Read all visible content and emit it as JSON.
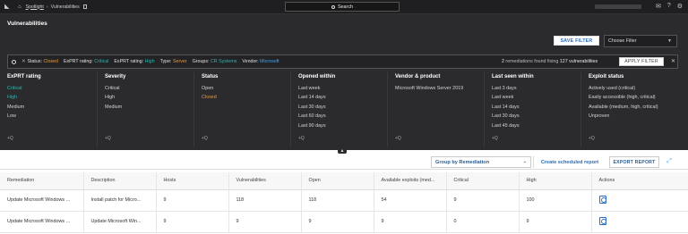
{
  "nav": {
    "app_name": "Spotlight",
    "page_name": "Vulnerabilities",
    "search_label": "Search"
  },
  "panel": {
    "title": "Vulnerabilities",
    "save_filter": "SAVE FILTER",
    "choose_filter": "Choose Filter"
  },
  "filters": [
    {
      "key": "Status:",
      "value": "Closed",
      "color": "orange"
    },
    {
      "key": "ExPRT rating:",
      "value": "Critical",
      "color": "teal"
    },
    {
      "key": "ExPRT rating:",
      "value": "High",
      "color": "teal"
    },
    {
      "key": "Type:",
      "value": "Server",
      "color": "orange"
    },
    {
      "key": "Groups:",
      "value": "CR Systems",
      "color": "teal"
    },
    {
      "key": "Vendor:",
      "value": "Microsoft",
      "color": "blue"
    }
  ],
  "summary": {
    "count": "2",
    "middle": " remediations found fixing ",
    "total": "127 vulnerabilities"
  },
  "apply_filter": "APPLY FILTER",
  "facets": [
    {
      "title": "ExPRT rating",
      "items": [
        "Critical",
        "High",
        "Medium",
        "Low"
      ],
      "active": [
        0,
        1
      ],
      "active_color": "teal"
    },
    {
      "title": "Severity",
      "items": [
        "Critical",
        "High",
        "Medium"
      ],
      "active": [],
      "active_color": "teal"
    },
    {
      "title": "Status",
      "items": [
        "Open",
        "Closed"
      ],
      "active": [
        1
      ],
      "active_color": "orange"
    },
    {
      "title": "Opened within",
      "items": [
        "Last week",
        "Last 14 days",
        "Last 30 days",
        "Last 60 days",
        "Last 90 days"
      ],
      "active": [],
      "active_color": "teal"
    },
    {
      "title": "Vendor & product",
      "items": [
        "Microsoft Windows Server 2019"
      ],
      "active": [],
      "active_color": "teal"
    },
    {
      "title": "Last seen within",
      "items": [
        "Last 3 days",
        "Last week",
        "Last 14 days",
        "Last 30 days",
        "Last 45 days"
      ],
      "active": [],
      "active_color": "teal"
    },
    {
      "title": "Exploit status",
      "items": [
        "Actively used (critical)",
        "Easily accessible (high, critical)",
        "Available (medium, high, critical)",
        "Unproven"
      ],
      "active": [],
      "active_color": "teal"
    }
  ],
  "add_query_label": "+Q",
  "toolbar": {
    "group_by": "Group by Remediation",
    "create_report": "Create scheduled report",
    "export": "EXPORT REPORT"
  },
  "table": {
    "headers": [
      "Remediation",
      "Description",
      "Hosts",
      "Vulnerabilities",
      "Open",
      "Available exploits (med...",
      "Critical",
      "High",
      "Actions"
    ],
    "rows": [
      [
        "Update Microsoft Windows ...",
        "Install patch for Micro...",
        "9",
        "118",
        "118",
        "54",
        "9",
        "100"
      ],
      [
        "Update Microsoft Windows ...",
        "Update Microsoft Win...",
        "9",
        "9",
        "9",
        "9",
        "0",
        "9"
      ]
    ]
  },
  "colors": {
    "teal": "#2fb4b0",
    "orange": "#e89a3a",
    "blue": "#4aa3e8",
    "panel_bg": "#2b2b2e",
    "accent_blue": "#2a6ebb"
  }
}
